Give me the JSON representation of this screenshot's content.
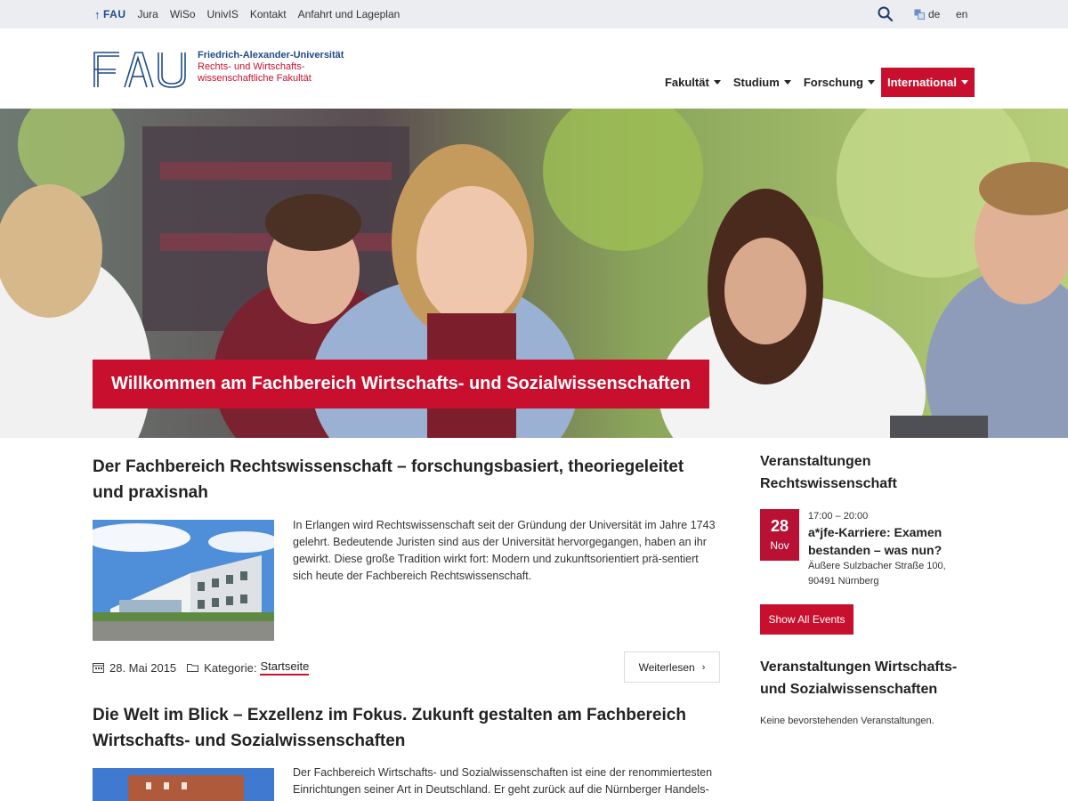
{
  "topbar": {
    "home_label": "FAU",
    "links": [
      "Jura",
      "WiSo",
      "UnivIS",
      "Kontakt",
      "Anfahrt und Lageplan"
    ],
    "lang_de": "de",
    "lang_en": "en"
  },
  "header": {
    "logo_letters": "FAU",
    "logo_line1": "Friedrich-Alexander-Universität",
    "logo_line2": "Rechts- und Wirtschafts-",
    "logo_line3": "wissenschaftliche Fakultät",
    "nav": [
      "Fakultät",
      "Studium",
      "Forschung",
      "International"
    ]
  },
  "hero": {
    "banner": "Willkommen am Fachbereich Wirtschafts- und Sozialwissenschaften"
  },
  "articles": [
    {
      "title": "Der Fachbereich Rechtswissenschaft – forschungsbasiert, theoriegeleitet und praxisnah",
      "excerpt": "In Erlangen wird Rechtswissenschaft seit der Gründung der Universität im Jahre 1743 gelehrt. Bedeutende Juristen sind aus der Universität hervorgegangen, haben an ihr gewirkt. Diese große Tradition wirkt fort: Modern und zukunftsorientiert prä-sentiert sich heute der Fachbereich Rechtswissenschaft.",
      "date": "28. Mai 2015",
      "category_label": "Kategorie:",
      "category": "Startseite",
      "more": "Weiterlesen"
    },
    {
      "title": "Die Welt im Blick – Exzellenz im Fokus. Zukunft gestalten am Fachbereich Wirtschafts- und Sozialwissenschaften",
      "excerpt": "Der Fachbereich Wirtschafts- und Sozialwissenschaften ist eine der renommiertesten Einrichtungen seiner Art in Deutschland. Er geht zurück auf die Nürnberger Handels-"
    }
  ],
  "sidebar": {
    "law_heading": "Veranstaltungen Rechtswissenschaft",
    "event": {
      "day": "28",
      "month": "Nov",
      "time": "17:00 – 20:00",
      "title": "a*jfe-Karriere: Examen bestanden – was nun?",
      "location_line1": "Äußere Sulzbacher Straße 100,",
      "location_line2": "90491 Nürnberg"
    },
    "show_all": "Show All Events",
    "wiso_heading": "Veranstaltungen Wirtschafts- und Sozialwissenschaften",
    "no_events": "Keine bevorstehenden Veranstaltungen."
  },
  "colors": {
    "accent": "#c8102e",
    "brand_blue": "#1f4a8a",
    "topbar_bg": "#ebedf0"
  },
  "icons": {
    "search": "search-icon",
    "language": "translate-icon",
    "calendar": "calendar-icon",
    "folder": "folder-icon",
    "chevron": "chevron-right-icon"
  }
}
